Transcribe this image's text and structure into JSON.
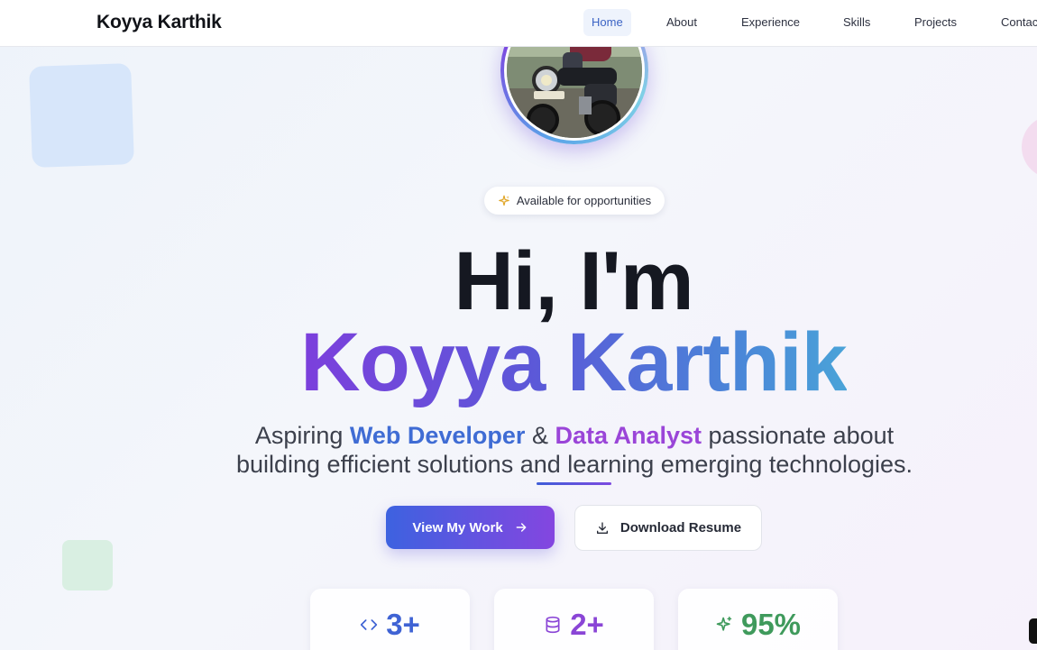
{
  "brand": "Koyya Karthik",
  "nav": {
    "items": [
      {
        "label": "Home"
      },
      {
        "label": "About"
      },
      {
        "label": "Experience"
      },
      {
        "label": "Skills"
      },
      {
        "label": "Projects"
      },
      {
        "label": "Contac"
      }
    ],
    "active_item": "Home"
  },
  "hero": {
    "badge": "Available for opportunities",
    "greeting": "Hi, I'm",
    "name": "Koyya Karthik",
    "tagline": {
      "prefix": "Aspiring ",
      "role1": "Web Developer",
      "conj": " & ",
      "role2": "Data Analyst",
      "suffix": " passionate about building efficient solutions and learning emerging technologies."
    }
  },
  "buttons": {
    "primary": "View My Work",
    "secondary": "Download Resume"
  },
  "stats": [
    {
      "value": "3+",
      "icon": "code-icon",
      "color": "#3f63d4"
    },
    {
      "value": "2+",
      "icon": "database-icon",
      "color": "#8a45d6"
    },
    {
      "value": "95%",
      "icon": "sparkle-icon",
      "color": "#3f9a5c"
    }
  ],
  "colors": {
    "accent_blue": "#3f6cd4",
    "accent_purple": "#9a45d8",
    "nav_active": "#3b63c4"
  }
}
